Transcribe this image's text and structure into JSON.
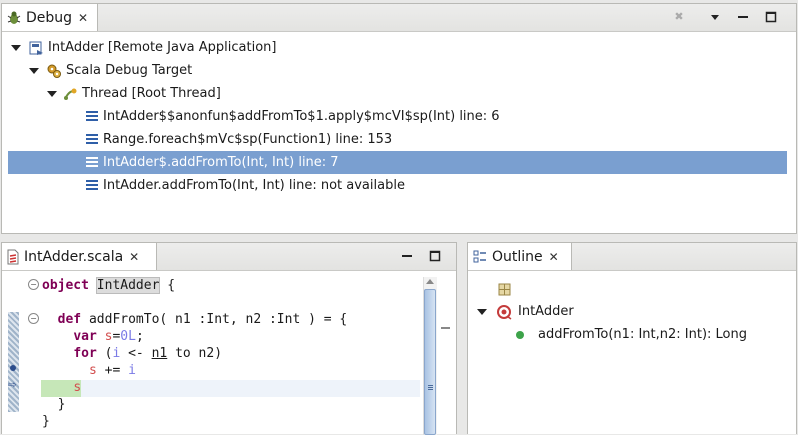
{
  "debug_view": {
    "tab_label": "Debug",
    "tree": {
      "launch": "IntAdder [Remote Java Application]",
      "target": "Scala Debug Target",
      "thread": "Thread [Root Thread]",
      "frames": [
        "IntAdder$$anonfun$addFromTo$1.apply$mcVI$sp(Int) line: 6",
        "Range.foreach$mVc$sp(Function1) line: 153",
        "IntAdder$.addFromTo(Int, Int) line: 7",
        "IntAdder.addFromTo(Int, Int) line: not available"
      ],
      "selected_frame_index": 2
    }
  },
  "editor": {
    "tab_label": "IntAdder.scala",
    "lines": [
      {
        "parts": [
          {
            "t": "object",
            "c": "kw"
          },
          {
            "t": " "
          },
          {
            "t": "IntAdder",
            "c": "hl"
          },
          {
            "t": " {"
          }
        ]
      },
      {
        "parts": [
          {
            "t": ""
          }
        ]
      },
      {
        "parts": [
          {
            "t": "  "
          },
          {
            "t": "def",
            "c": "kw"
          },
          {
            "t": " addFromTo( n1 :Int, n2 :Int ) = {"
          }
        ]
      },
      {
        "parts": [
          {
            "t": "    "
          },
          {
            "t": "var",
            "c": "kw"
          },
          {
            "t": " "
          },
          {
            "t": "s",
            "c": "var"
          },
          {
            "t": "="
          },
          {
            "t": "0L",
            "c": "num"
          },
          {
            "t": ";"
          }
        ]
      },
      {
        "parts": [
          {
            "t": "    "
          },
          {
            "t": "for",
            "c": "kw"
          },
          {
            "t": " ("
          },
          {
            "t": "i",
            "c": "num"
          },
          {
            "t": " <- "
          },
          {
            "t": "n1",
            "c": "ul"
          },
          {
            "t": " to n2)"
          }
        ]
      },
      {
        "parts": [
          {
            "t": "      "
          },
          {
            "t": "s",
            "c": "var"
          },
          {
            "t": " += "
          },
          {
            "t": "i",
            "c": "num"
          }
        ]
      },
      {
        "parts": [
          {
            "t": "    "
          },
          {
            "t": "s",
            "c": "var"
          }
        ]
      },
      {
        "parts": [
          {
            "t": "  }"
          }
        ]
      },
      {
        "parts": [
          {
            "t": "}"
          }
        ]
      }
    ],
    "current_line_index": 6
  },
  "outline": {
    "tab_label": "Outline",
    "object_name": "IntAdder",
    "method": "addFromTo(n1: Int,n2: Int): Long"
  },
  "colors": {
    "selection": "#7a9fd0",
    "current_line": "#c6e7b8",
    "keyword": "#7f0055"
  }
}
